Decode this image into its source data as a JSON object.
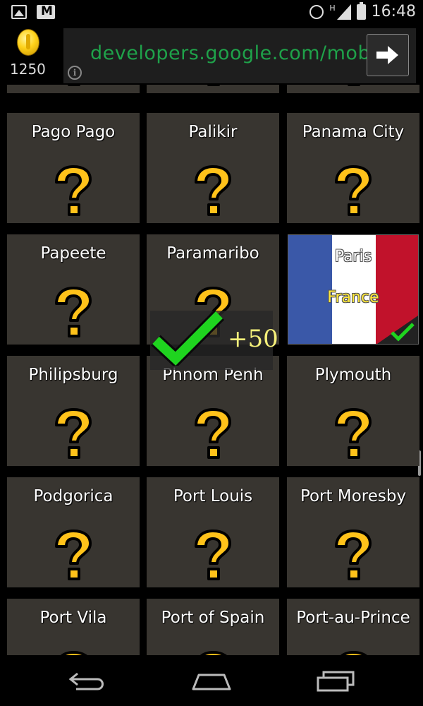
{
  "status_bar": {
    "time": "16:48",
    "network": "H",
    "icons": [
      "gallery-icon",
      "gmail-icon",
      "alarm-icon",
      "signal-icon",
      "battery-icon"
    ]
  },
  "header": {
    "coins": "1250",
    "ad_url": "developers.google.com/mob…"
  },
  "tiles": [
    {
      "name": "Pago Pago",
      "state": "unknown"
    },
    {
      "name": "Palikir",
      "state": "unknown"
    },
    {
      "name": "Panama City",
      "state": "unknown"
    },
    {
      "name": "Papeete",
      "state": "unknown"
    },
    {
      "name": "Paramaribo",
      "state": "unknown"
    },
    {
      "name": "Paris",
      "country": "France",
      "state": "solved"
    },
    {
      "name": "Philipsburg",
      "state": "unknown"
    },
    {
      "name": "Phnom Penh",
      "state": "unknown"
    },
    {
      "name": "Plymouth",
      "state": "unknown"
    },
    {
      "name": "Podgorica",
      "state": "unknown"
    },
    {
      "name": "Port Louis",
      "state": "unknown"
    },
    {
      "name": "Port Moresby",
      "state": "unknown"
    },
    {
      "name": "Port Vila",
      "state": "unknown"
    },
    {
      "name": "Port of Spain",
      "state": "unknown"
    },
    {
      "name": "Port-au-Prince",
      "state": "unknown"
    }
  ],
  "reward": {
    "points": "+50"
  },
  "colors": {
    "tile": "#383530",
    "question_mark": "#ffc21a",
    "check": "#1fd41f",
    "reward_text": "#f5f07a",
    "ad_url": "#1fa24a"
  }
}
